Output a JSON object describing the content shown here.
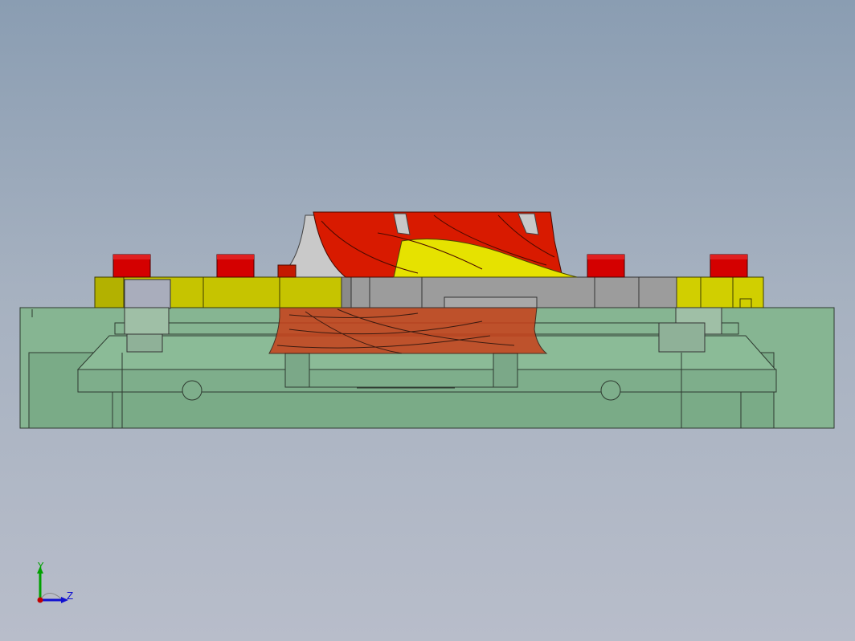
{
  "viewport": {
    "background_top": "#8a9db2",
    "background_bottom": "#b8bdca"
  },
  "model": {
    "colors": {
      "base_block": "#86b592",
      "base_edge": "#2e3a30",
      "clamp_plate": "#c6c400",
      "clamp_plate_dark": "#9f9d00",
      "red_caps": "#d40000",
      "impeller_red": "#d81a00",
      "impeller_orange": "#c8401a",
      "impeller_yellow": "#e6e200",
      "hub_gray": "#9c9c9c",
      "bolt_gray": "#a9adbc"
    }
  },
  "triad": {
    "y_label": "Y",
    "z_label": "Z",
    "y_color": "#00a000",
    "z_color": "#1010d0",
    "origin_color": "#c00000"
  }
}
